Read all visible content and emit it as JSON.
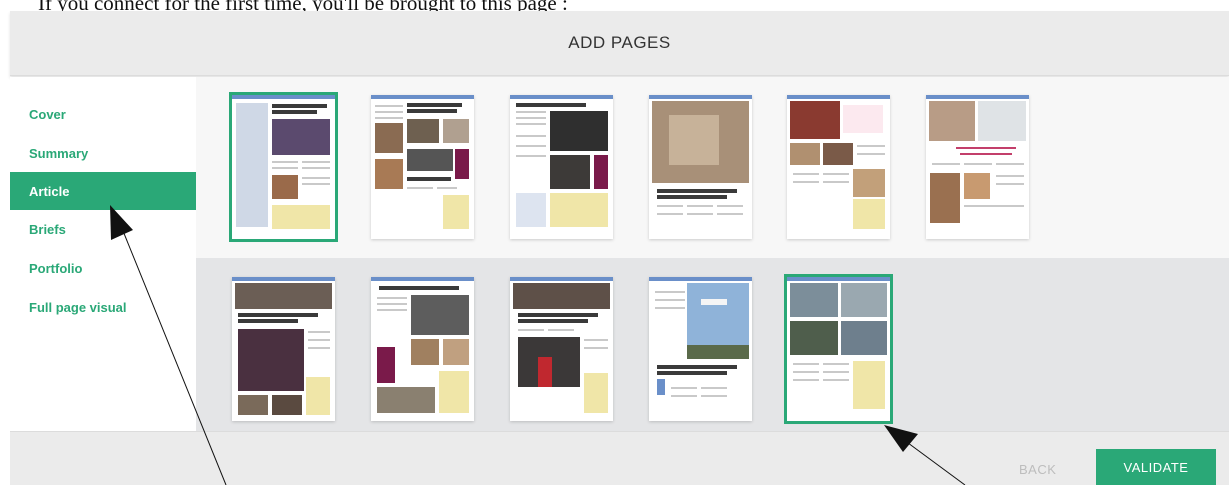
{
  "caption": "If you connect for the first time, you'll be brought to this page :",
  "header": {
    "title": "ADD PAGES"
  },
  "sidebar": {
    "items": [
      {
        "label": "Cover"
      },
      {
        "label": "Summary"
      },
      {
        "label": "Article"
      },
      {
        "label": "Briefs"
      },
      {
        "label": "Portfolio"
      },
      {
        "label": "Full page visual"
      }
    ],
    "active_item": "Article"
  },
  "templates": {
    "row1": [
      {
        "selected": true
      },
      {
        "selected": false
      },
      {
        "selected": false
      },
      {
        "selected": false
      },
      {
        "selected": false
      },
      {
        "selected": false
      }
    ],
    "row2": [
      {
        "selected": false
      },
      {
        "selected": false
      },
      {
        "selected": false
      },
      {
        "selected": false
      },
      {
        "selected": true
      }
    ]
  },
  "footer": {
    "back_label": "BACK",
    "validate_label": "VALIDATE"
  },
  "colors": {
    "accent": "#2aa877",
    "header_bg": "#ebebeb",
    "row2_bg": "#e4e5e7"
  }
}
